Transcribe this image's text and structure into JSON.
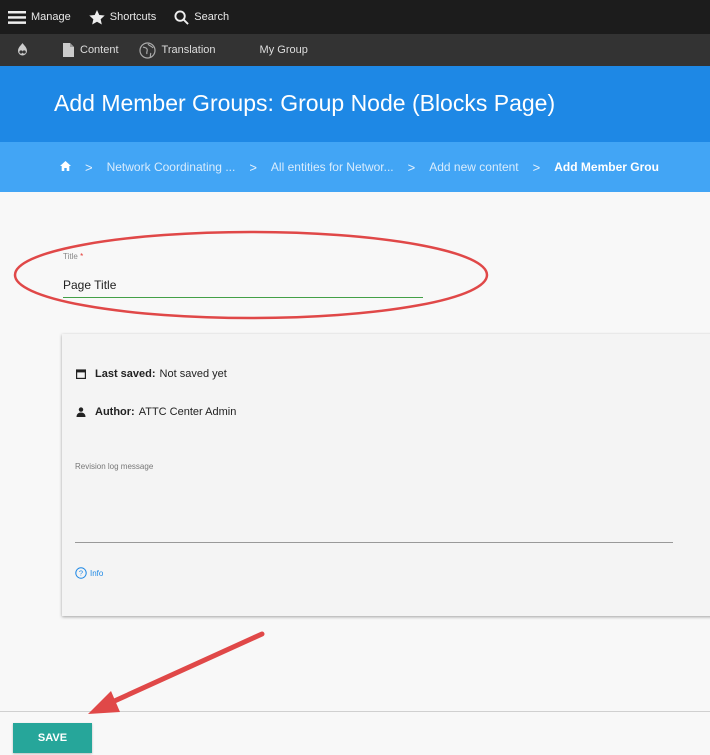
{
  "toolbar": {
    "manage": "Manage",
    "shortcuts": "Shortcuts",
    "search": "Search"
  },
  "subtoolbar": {
    "content": "Content",
    "translation": "Translation",
    "my_group": "My Group"
  },
  "header": {
    "title": "Add Member Groups: Group Node (Blocks Page)"
  },
  "breadcrumb": {
    "items": [
      "Network Coordinating ...",
      "All entities for Networ...",
      "Add new content",
      "Add Member Grou"
    ],
    "separator": ">"
  },
  "form": {
    "title_label": "Title",
    "required_mark": "*",
    "title_value": "Page Title",
    "last_saved_label": "Last saved:",
    "last_saved_value": "Not saved yet",
    "author_label": "Author:",
    "author_value": "ATTC Center Admin",
    "revision_label": "Revision log message",
    "info_label": "Info"
  },
  "actions": {
    "save_label": "SAVE"
  },
  "colors": {
    "header": "#1e88e5",
    "breadcrumb": "#42a5f5",
    "save_button": "#26a69a",
    "annotation": "#e53935",
    "input_underline": "#43a047"
  }
}
